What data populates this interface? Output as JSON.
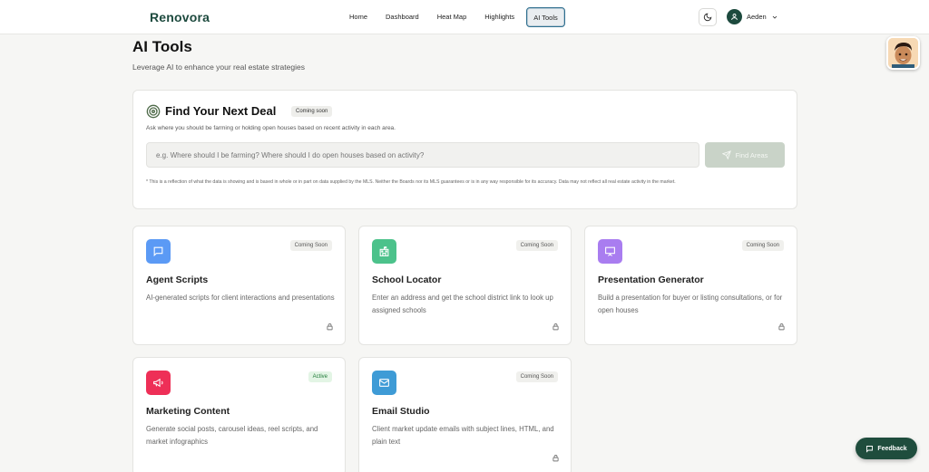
{
  "brand": "Renovora",
  "nav": [
    {
      "label": "Home"
    },
    {
      "label": "Dashboard"
    },
    {
      "label": "Heat Map"
    },
    {
      "label": "Highlights"
    },
    {
      "label": "AI Tools",
      "active": true
    }
  ],
  "user": {
    "name": "Aeden"
  },
  "page": {
    "title": "AI Tools",
    "subtitle": "Leverage AI to enhance your real estate strategies"
  },
  "deal": {
    "title": "Find Your Next Deal",
    "badge": "Coming soon",
    "description": "Ask where you should be farming or holding open houses based on recent activity in each area.",
    "placeholder": "e.g. Where should I be farming? Where should I do open houses based on activity?",
    "button": "Find Areas",
    "note": "* This is a reflection of what the data is showing and is based in whole or in part on data supplied by the MLS. Neither the Boards nor its MLS guarantees or is in any way responsible for its accuracy. Data may not reflect all real estate activity in the market."
  },
  "tools": [
    {
      "title": "Agent Scripts",
      "badge": "Coming Soon",
      "description": "AI-generated scripts for client interactions and presentations",
      "icon": "chat-icon",
      "color": "#5b9af5",
      "locked": true
    },
    {
      "title": "School Locator",
      "badge": "Coming Soon",
      "description": "Enter an address and get the school district link to look up assigned schools",
      "icon": "school-icon",
      "color": "#4cc28b",
      "locked": true
    },
    {
      "title": "Presentation Generator",
      "badge": "Coming Soon",
      "description": "Build a presentation for buyer or listing consultations, or for open houses",
      "icon": "presentation-icon",
      "color": "#a97df0",
      "locked": true
    },
    {
      "title": "Marketing Content",
      "badge": "Active",
      "description": "Generate social posts, carousel ideas, reel scripts, and market infographics",
      "icon": "megaphone-icon",
      "color": "#ee2f57",
      "locked": false
    },
    {
      "title": "Email Studio",
      "badge": "Coming Soon",
      "description": "Client market update emails with subject lines, HTML, and plain text",
      "icon": "mail-icon",
      "color": "#3e9bd6",
      "locked": true
    }
  ],
  "feedback": "Feedback"
}
